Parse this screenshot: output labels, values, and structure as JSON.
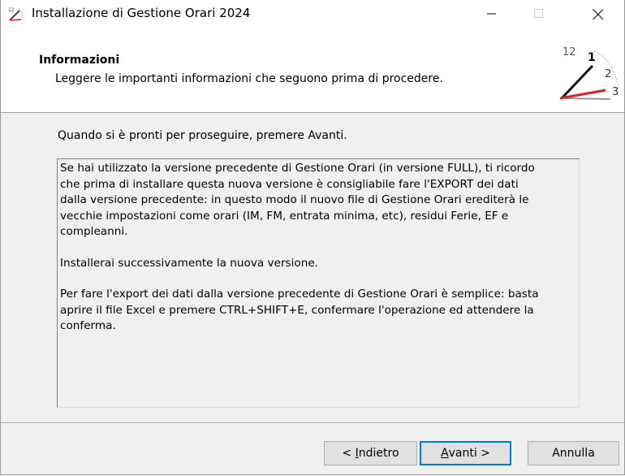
{
  "window": {
    "title": "Installazione di Gestione Orari 2024"
  },
  "header": {
    "title": "Informazioni",
    "description": "Leggere le importanti informazioni che seguono prima di procedere."
  },
  "intro_text": "Quando si è pronti per proseguire, premere Avanti.",
  "info_paragraphs": [
    "Se hai utilizzato la versione precedente di Gestione Orari (in versione FULL), ti ricordo\nche prima di installare questa nuova versione è consigliabile fare l'EXPORT dei dati\ndalla versione precedente: in questo modo il nuovo file di Gestione Orari erediterà le\nvecchie impostazioni come orari (IM, FM, entrata minima, etc), residui Ferie, EF e\ncompleanni.",
    "Installerai successivamente la nuova versione.",
    "Per fare l'export dei dati dalla versione precedente di Gestione Orari è semplice: basta\naprire il file Excel e premere CTRL+SHIFT+E, confermare l'operazione ed attendere la\nconferma."
  ],
  "buttons": {
    "back": {
      "prefix": "< ",
      "accel": "I",
      "rest": "ndietro"
    },
    "next": {
      "prefix": "",
      "accel": "A",
      "rest": "vanti >"
    },
    "cancel": "Annulla"
  },
  "clock_numbers": [
    "12",
    "1",
    "2",
    "3"
  ],
  "colors": {
    "accent": "#0078d7",
    "clock_hand_red": "#e02020"
  },
  "icons": {
    "app": "installer-clock-icon",
    "header": "clock-icon",
    "minimize": "minimize-icon",
    "maximize": "maximize-icon",
    "close": "close-icon"
  }
}
